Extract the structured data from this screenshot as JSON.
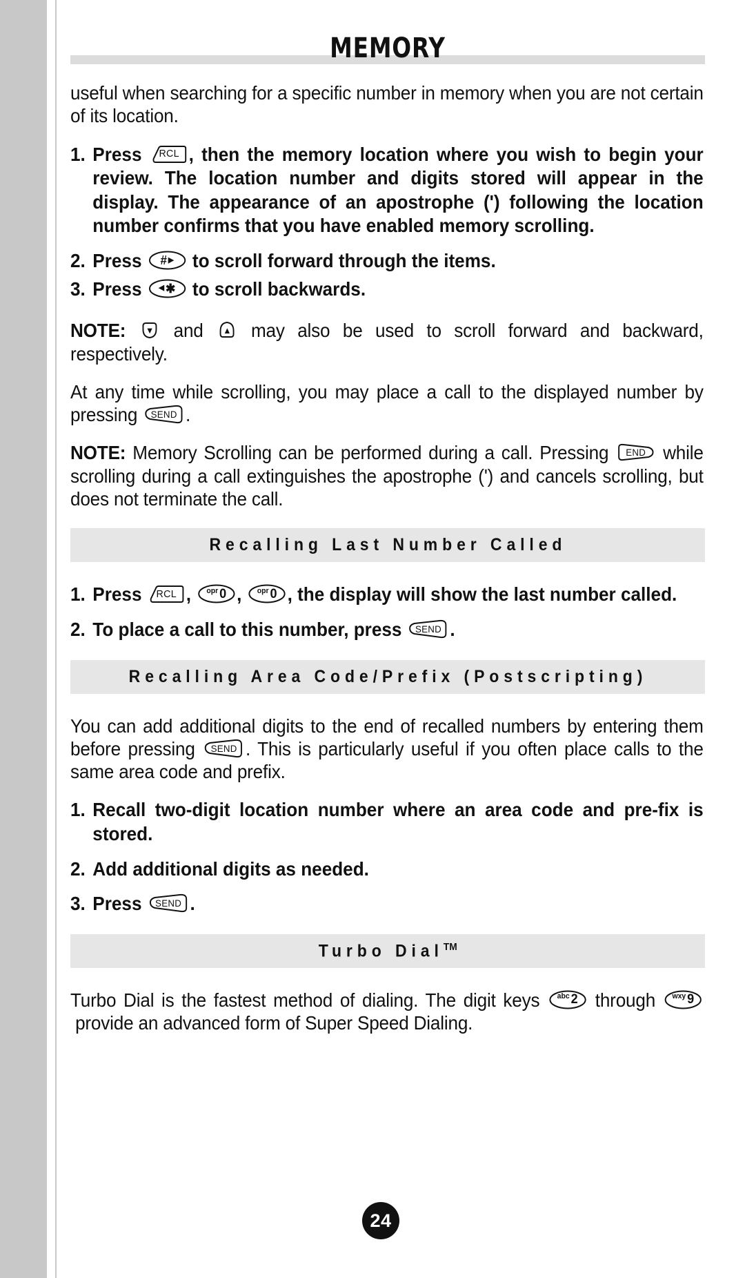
{
  "page": {
    "running_head": "MEMORY",
    "page_number": "24",
    "accent_gray": "#dcdcdc",
    "bar_gray": "#e6e6e6",
    "gutter_gray": "#c8c8c8"
  },
  "intro": {
    "text": "useful when searching for a specific number in memory when you are not certain of its location."
  },
  "memory_scrolling_steps": [
    {
      "num": "1.",
      "lead": "Press",
      "key": "RCL",
      "text": ", then the memory location where you wish to begin your review. The location number and digits stored will appear in the display. The appearance of an apostrophe (') following the location number confirms that you have enabled memory scrolling."
    },
    {
      "num": "2.",
      "lead": "Press",
      "key": "#",
      "text": "to scroll forward through the items."
    },
    {
      "num": "3.",
      "lead": "Press",
      "key": "*",
      "text": "to scroll backwards."
    }
  ],
  "note_scroll": {
    "label": "NOTE:",
    "mid": "and",
    "text": "may also be used to scroll forward and backward, respectively.",
    "key_down": "down-arrow",
    "key_up": "up-arrow"
  },
  "para_call": {
    "before": "At any time while scrolling, you may place a call to the displayed number by pressing",
    "key": "SEND",
    "after": "."
  },
  "note_during_call": {
    "label": "NOTE:",
    "before": "Memory Scrolling can be performed during a call. Pressing",
    "key": "END",
    "after": "while scrolling during a call extinguishes the apostrophe (') and cancels scrolling, but does not terminate the call."
  },
  "section_recalling_last": {
    "heading": "Recalling Last Number Called",
    "steps": [
      {
        "num": "1.",
        "lead": "Press",
        "keys": [
          "RCL",
          "opr0",
          "opr0"
        ],
        "text": ", the display will show the last number called."
      },
      {
        "num": "2.",
        "lead": "To place a call to this number, press",
        "keys": [
          "SEND"
        ],
        "text": "."
      }
    ]
  },
  "section_postscripting": {
    "heading": "Recalling Area Code/Prefix (Postscripting)",
    "paragraph_before": "You can add additional digits to the end of recalled numbers by entering them before pressing",
    "paragraph_key": "SEND",
    "paragraph_after": ". This is particularly useful if you often place calls to the same area code and prefix.",
    "steps": [
      {
        "num": "1.",
        "text": "Recall two-digit location number where an area code and pre-fix is stored."
      },
      {
        "num": "2.",
        "text": "Add additional digits as needed."
      },
      {
        "num": "3.",
        "lead": "Press",
        "key": "SEND",
        "text": "."
      }
    ]
  },
  "section_turbo_dial": {
    "heading": "Turbo Dial",
    "heading_tm": "TM",
    "paragraph_before": "Turbo Dial is the fastest method of dialing. The digit keys",
    "key_first": "abc2",
    "paragraph_mid": "through",
    "key_second": "wxy9",
    "paragraph_after": "provide an advanced form of Super Speed Dialing."
  }
}
